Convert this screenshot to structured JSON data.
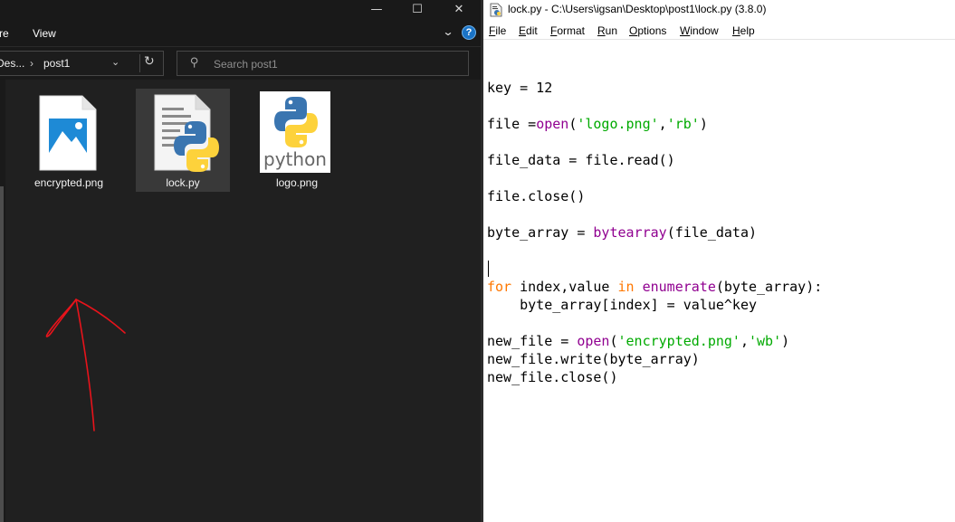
{
  "explorer": {
    "window_controls": {
      "minimize": "—",
      "maximize": "☐",
      "close": "✕"
    },
    "ribbon": {
      "tab_partial": "re",
      "tab_view": "View"
    },
    "address": {
      "crumb_partial": "Des...",
      "separator": "›",
      "crumb_current": "post1"
    },
    "search": {
      "placeholder": "Search post1"
    },
    "files": [
      {
        "name": "encrypted.png",
        "icon": "image-file-icon",
        "selected": false
      },
      {
        "name": "lock.py",
        "icon": "python-script-icon",
        "selected": true
      },
      {
        "name": "logo.png",
        "icon": "python-logo-thumbnail",
        "selected": false
      }
    ],
    "thumbnail_text": "python"
  },
  "idle": {
    "title": "lock.py - C:\\Users\\igsan\\Desktop\\post1\\lock.py (3.8.0)",
    "menu": [
      {
        "ul": "F",
        "rest": "ile"
      },
      {
        "ul": "E",
        "rest": "dit"
      },
      {
        "ul": "F",
        "rest": "ormat"
      },
      {
        "ul": "R",
        "rest": "un"
      },
      {
        "ul": "O",
        "rest": "ptions"
      },
      {
        "ul": "W",
        "rest": "indow"
      },
      {
        "ul": "H",
        "rest": "elp"
      }
    ]
  },
  "colors": {
    "keyword": "#ff7700",
    "builtin": "#900090",
    "string": "#00aa00",
    "explorer_bg": "#202020",
    "selection": "#393939",
    "annotation_arrow": "#e8131b"
  }
}
